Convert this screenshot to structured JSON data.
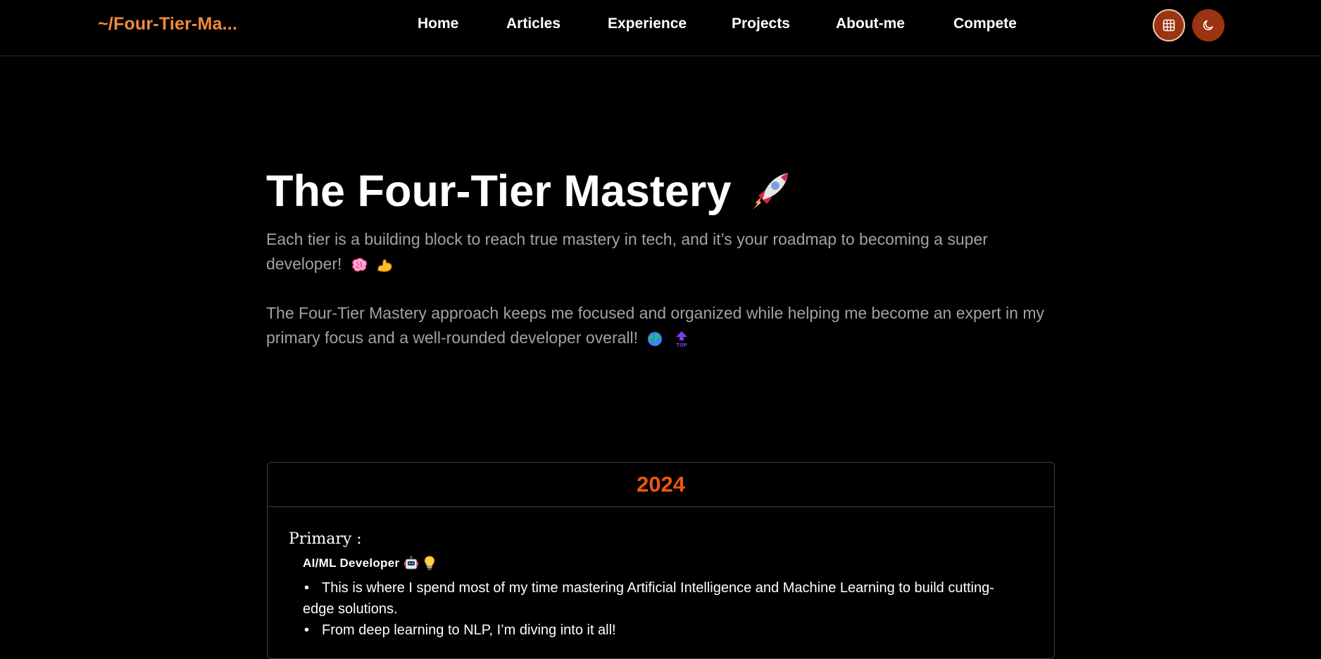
{
  "header": {
    "brand": "~/Four-Tier-Ma...",
    "nav": [
      {
        "label": "Home"
      },
      {
        "label": "Articles"
      },
      {
        "label": "Experience"
      },
      {
        "label": "Projects"
      },
      {
        "label": "About-me"
      },
      {
        "label": "Compete"
      }
    ],
    "icons": {
      "grid": "grid-icon",
      "theme": "moon-icon"
    },
    "accent_color": "#9a3412"
  },
  "hero": {
    "title": "The Four-Tier Mastery",
    "title_icon": "rocket-icon",
    "paragraph_1": "Each tier is a building block to reach true mastery in tech, and it’s your roadmap to becoming a super developer!",
    "paragraph_1_icons": [
      "brain-icon",
      "flexed-biceps-icon"
    ],
    "paragraph_2": "The Four-Tier Mastery approach keeps me focused and organized while helping me become an expert in my primary focus and a well-rounded developer overall!",
    "paragraph_2_icons": [
      "globe-icon",
      "top-arrow-icon"
    ]
  },
  "card": {
    "year": "2024",
    "year_color": "#ea580c",
    "tier_label": "Primary :",
    "role": "AI/ML Developer",
    "role_icons": [
      "robot-icon",
      "light-bulb-icon"
    ],
    "bullets": [
      "This is where I spend most of my time mastering Artificial Intelligence and Machine Learning to build cutting-edge solutions.",
      "From deep learning to NLP, I’m diving into it all!"
    ]
  }
}
